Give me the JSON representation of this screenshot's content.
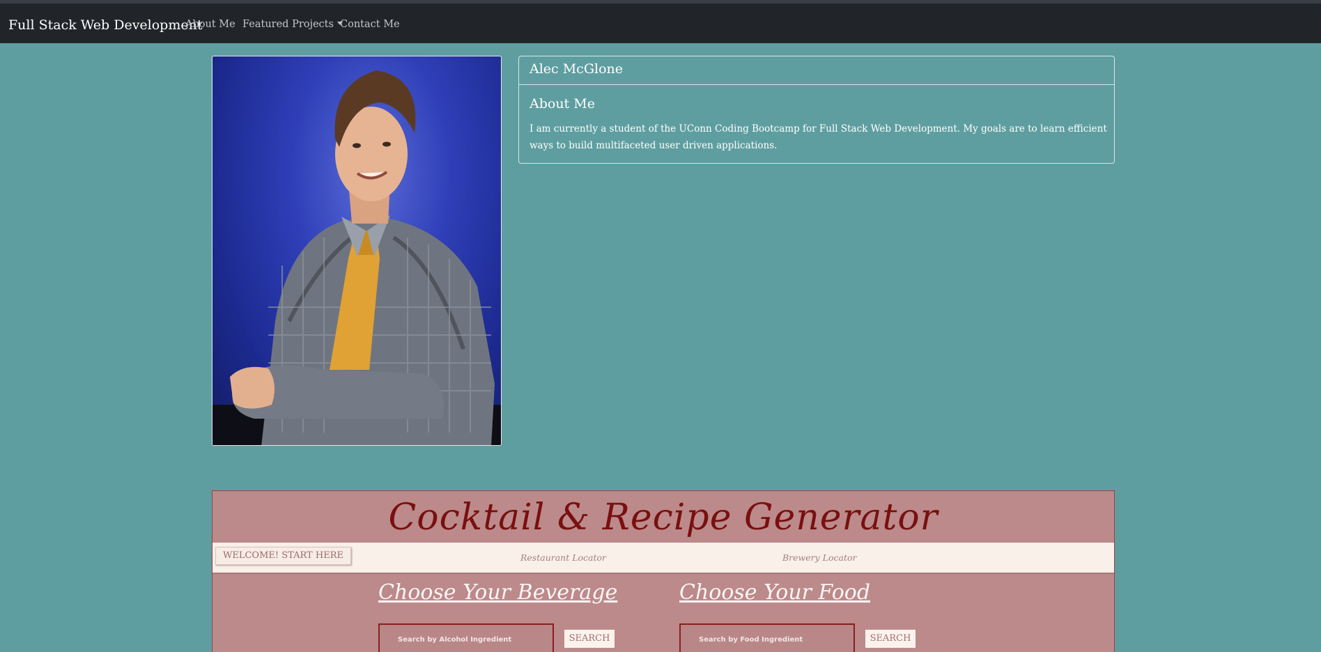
{
  "navbar": {
    "brand": "Full Stack Web Development",
    "links": [
      "About Me",
      "Featured Projects",
      "Contact Me"
    ]
  },
  "about_card": {
    "header": "Alec McGlone",
    "title": "About Me",
    "text": "I am currently a student of the UConn Coding Bootcamp for Full Stack Web Development. My goals are to learn efficient ways to build multifaceted user driven applications."
  },
  "project_preview": {
    "title": "Cocktail & Recipe Generator",
    "welcome_button": "WELCOME! START HERE",
    "nav_links": [
      "Restaurant Locator",
      "Brewery Locator"
    ],
    "beverage_heading": "Choose Your Beverage",
    "food_heading": "Choose Your Food",
    "beverage_placeholder": "Search by Alcohol Ingredient",
    "food_placeholder": "Search by Food Ingredient",
    "search_label": "SEARCH"
  },
  "colors": {
    "page_background": "#5f9ea0",
    "navbar": "#212529",
    "project_background": "#bc8a8a",
    "project_title": "#7a0f0f"
  },
  "icons": [
    "dropdown-caret-icon"
  ]
}
